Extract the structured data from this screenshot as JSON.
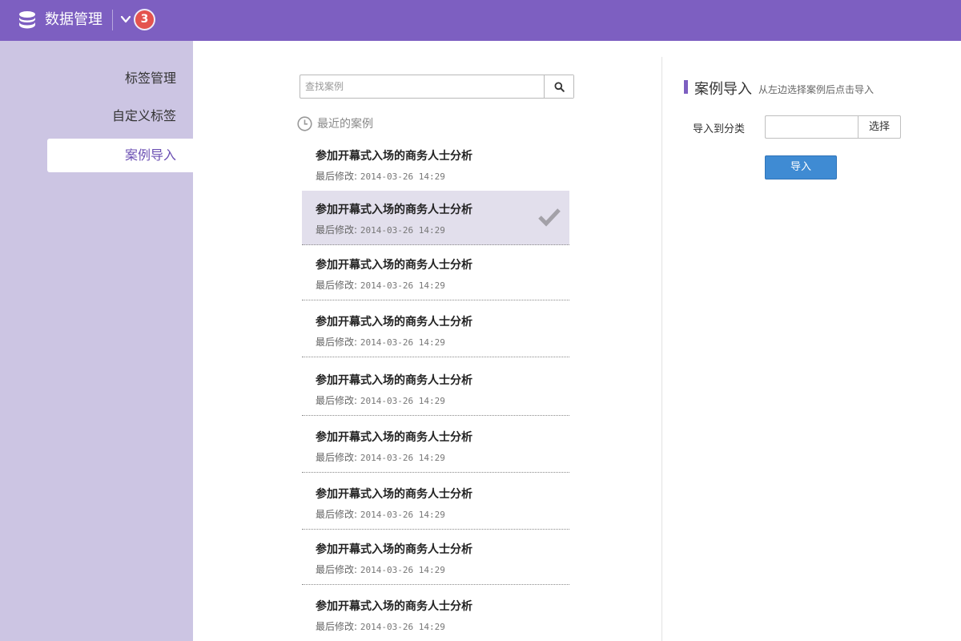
{
  "header": {
    "title": "数据管理",
    "badge": "3",
    "logo_icon": "database-icon",
    "menu_icon": "chevron-down-icon",
    "color": "#7d5fc1"
  },
  "sidebar": {
    "items": [
      {
        "label": "标签管理",
        "active": false
      },
      {
        "label": "自定义标签",
        "active": false
      },
      {
        "label": "案例导入",
        "active": true
      }
    ]
  },
  "search": {
    "placeholder": "查找案例",
    "icon": "search-icon"
  },
  "recent": {
    "label": "最近的案例",
    "icon": "clock-icon"
  },
  "cases": [
    {
      "name": "参加开幕式入场的商务人士分析",
      "modified_label": "最后修改:",
      "modified": "2014-03-26 14:29",
      "selected": false
    },
    {
      "name": "参加开幕式入场的商务人士分析",
      "modified_label": "最后修改:",
      "modified": "2014-03-26 14:29",
      "selected": true
    },
    {
      "name": "参加开幕式入场的商务人士分析",
      "modified_label": "最后修改:",
      "modified": "2014-03-26 14:29",
      "selected": false
    },
    {
      "name": "参加开幕式入场的商务人士分析",
      "modified_label": "最后修改:",
      "modified": "2014-03-26 14:29",
      "selected": false
    },
    {
      "name": "参加开幕式入场的商务人士分析",
      "modified_label": "最后修改:",
      "modified": "2014-03-26 14:29",
      "selected": false
    },
    {
      "name": "参加开幕式入场的商务人士分析",
      "modified_label": "最后修改:",
      "modified": "2014-03-26 14:29",
      "selected": false
    },
    {
      "name": "参加开幕式入场的商务人士分析",
      "modified_label": "最后修改:",
      "modified": "2014-03-26 14:29",
      "selected": false
    },
    {
      "name": "参加开幕式入场的商务人士分析",
      "modified_label": "最后修改:",
      "modified": "2014-03-26 14:29",
      "selected": false
    },
    {
      "name": "参加开幕式入场的商务人士分析",
      "modified_label": "最后修改:",
      "modified": "2014-03-26 14:29",
      "selected": false
    }
  ],
  "panel": {
    "title": "案例导入",
    "hint": "从左边选择案例后点击导入",
    "field_label": "导入到分类",
    "field_value": "",
    "choose_label": "选择",
    "import_label": "导入"
  }
}
